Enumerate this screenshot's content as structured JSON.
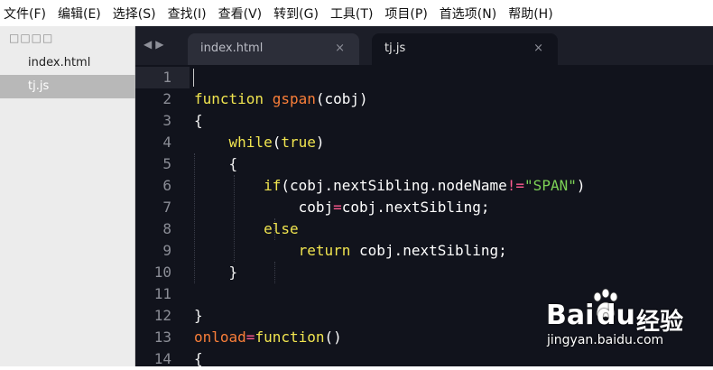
{
  "menubar": {
    "items": [
      "文件(F)",
      "编辑(E)",
      "选择(S)",
      "查找(I)",
      "查看(V)",
      "转到(G)",
      "工具(T)",
      "项目(P)",
      "首选项(N)",
      "帮助(H)"
    ]
  },
  "sidebar": {
    "header": "□□□□",
    "files": [
      "index.html",
      "tj.js"
    ],
    "active_index": 1
  },
  "tabs": [
    {
      "label": "index.html",
      "close": "×"
    },
    {
      "label": "tj.js",
      "close": "×"
    }
  ],
  "nav": {
    "prev": "◀",
    "next": "▶"
  },
  "editor": {
    "line_numbers": [
      "1",
      "2",
      "3",
      "4",
      "5",
      "6",
      "7",
      "8",
      "9",
      "10",
      "11",
      "12",
      "13",
      "14"
    ]
  },
  "code": {
    "l2": {
      "kw": "function",
      "name": "gspan",
      "rest": "(cobj)"
    },
    "l3": "{",
    "l4": {
      "kw1": "while",
      "p1": "(",
      "kw2": "true",
      "p2": ")"
    },
    "l5": "{",
    "l6": {
      "kw": "if",
      "a": "(cobj.nextSibling.nodeName",
      "op": "!=",
      "str": "\"SPAN\"",
      "b": ")"
    },
    "l7": {
      "a": "cobj",
      "op": "=",
      "b": "cobj.nextSibling;"
    },
    "l8": "else",
    "l9": {
      "kw": "return",
      "b": " cobj.nextSibling;"
    },
    "l10": "}",
    "l12": "}",
    "l13": {
      "name": "onload",
      "op": "=",
      "kw": "function",
      "rest": "()"
    },
    "l14": "{"
  },
  "watermark": {
    "brand_a": "Bai",
    "brand_b": "du",
    "brand_c": "经验",
    "url": "jingyan.baidu.com"
  },
  "colors": {
    "keyword": "#f0e44f",
    "function_name": "#f97e39",
    "string": "#7cd156",
    "operator": "#ff5b8f",
    "background": "#11131c"
  }
}
